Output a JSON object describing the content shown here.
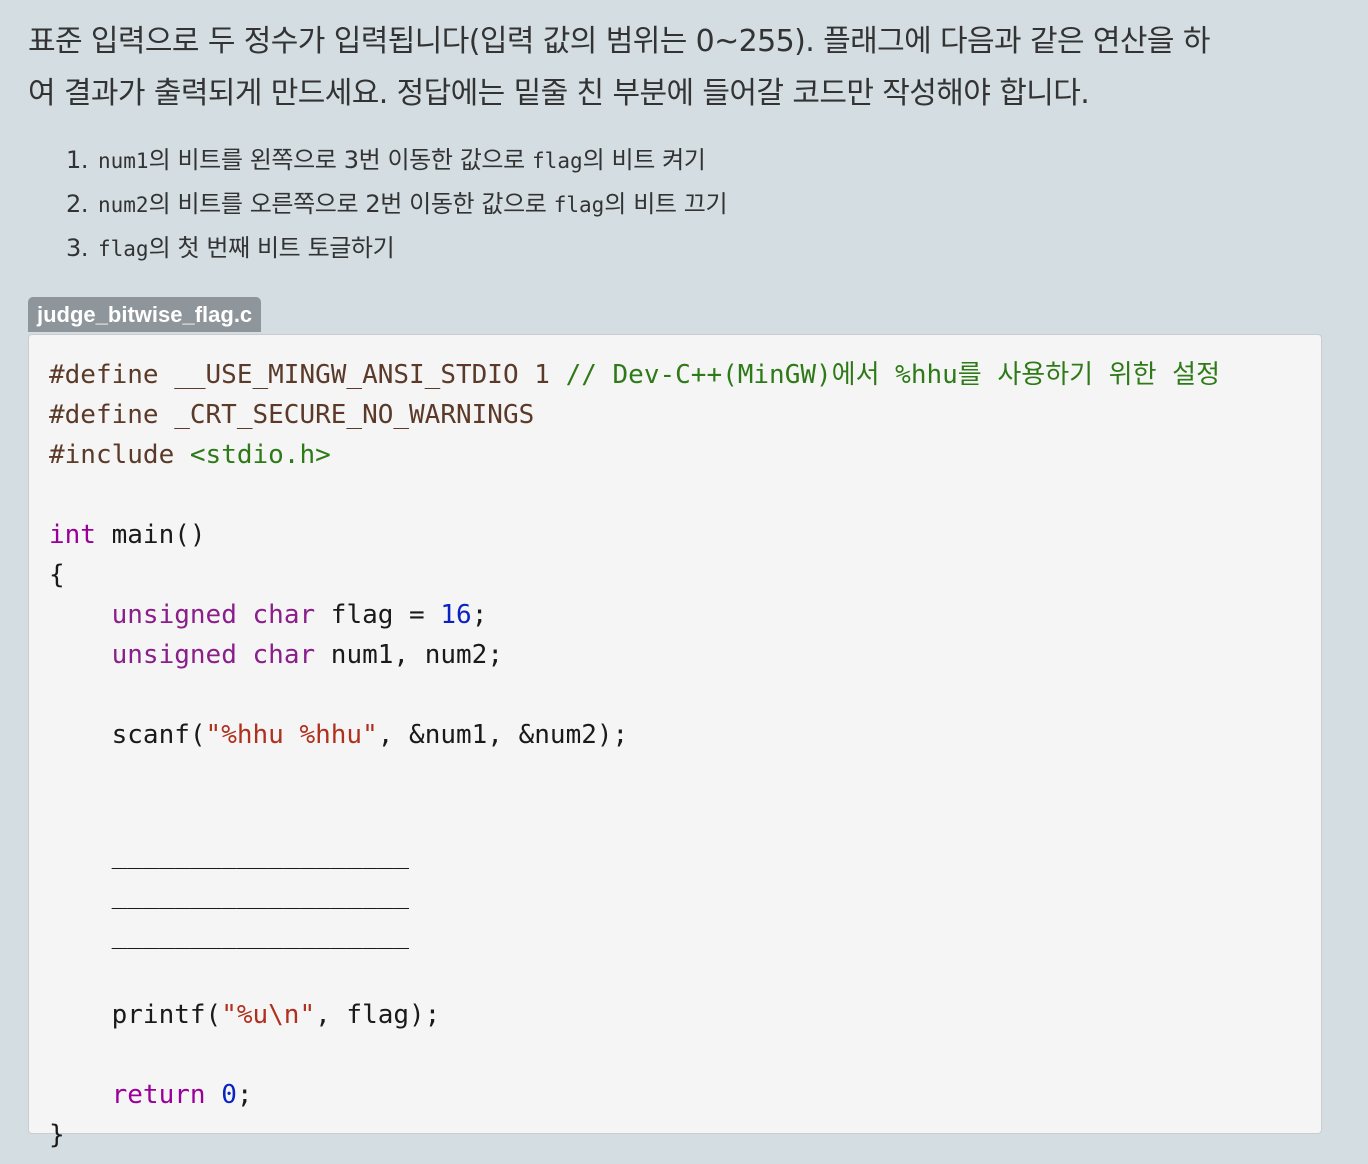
{
  "intro": {
    "line1": "표준 입력으로 두 정수가 입력됩니다(입력 값의 범위는 0~255). 플래그에 다음과 같은 연산을 하",
    "line2": "여 결과가 출력되게 만드세요. 정답에는 밑줄 친 부분에 들어갈 코드만 작성해야 합니다."
  },
  "steps": [
    {
      "num": "1.",
      "var": "num1",
      "text": "의 비트를 왼쪽으로 3번 이동한 값으로 ",
      "var2": "flag",
      "text2": "의 비트 켜기"
    },
    {
      "num": "2.",
      "var": "num2",
      "text": "의 비트를 오른쪽으로 2번 이동한 값으로 ",
      "var2": "flag",
      "text2": "의 비트 끄기"
    },
    {
      "num": "3.",
      "var": "flag",
      "text": "의 첫 번째 비트 토글하기",
      "var2": "",
      "text2": ""
    }
  ],
  "file": {
    "name": "judge_bitwise_flag.c"
  },
  "code": {
    "l1_a": "#define __USE_MINGW_ANSI_STDIO 1 ",
    "l1_comment": "// Dev-C++(MinGW)에서 %hhu를 사용하기 위한 설정",
    "l2": "#define _CRT_SECURE_NO_WARNINGS",
    "l3_a": "#include ",
    "l3_b": "<stdio.h>",
    "l5_kw": "int",
    "l5_rest": " main()",
    "l6": "{",
    "l7_indent": "    ",
    "l7_kw1": "unsigned",
    "l7_kw2": "char",
    "l7_rest": " flag = ",
    "l7_num": "16",
    "l7_end": ";",
    "l8_rest": " num1, num2;",
    "l10_a": "    scanf(",
    "l10_str": "\"%hhu %hhu\"",
    "l10_b": ", &num1, &num2);",
    "blank1": "    ___________________",
    "blank2": "    ___________________",
    "blank3": "    ___________________",
    "l16_a": "    printf(",
    "l16_str": "\"%u\\n\"",
    "l16_b": ", flag);",
    "l18_kw": "return",
    "l18_num": "0",
    "l18_end": ";",
    "l19": "}"
  }
}
